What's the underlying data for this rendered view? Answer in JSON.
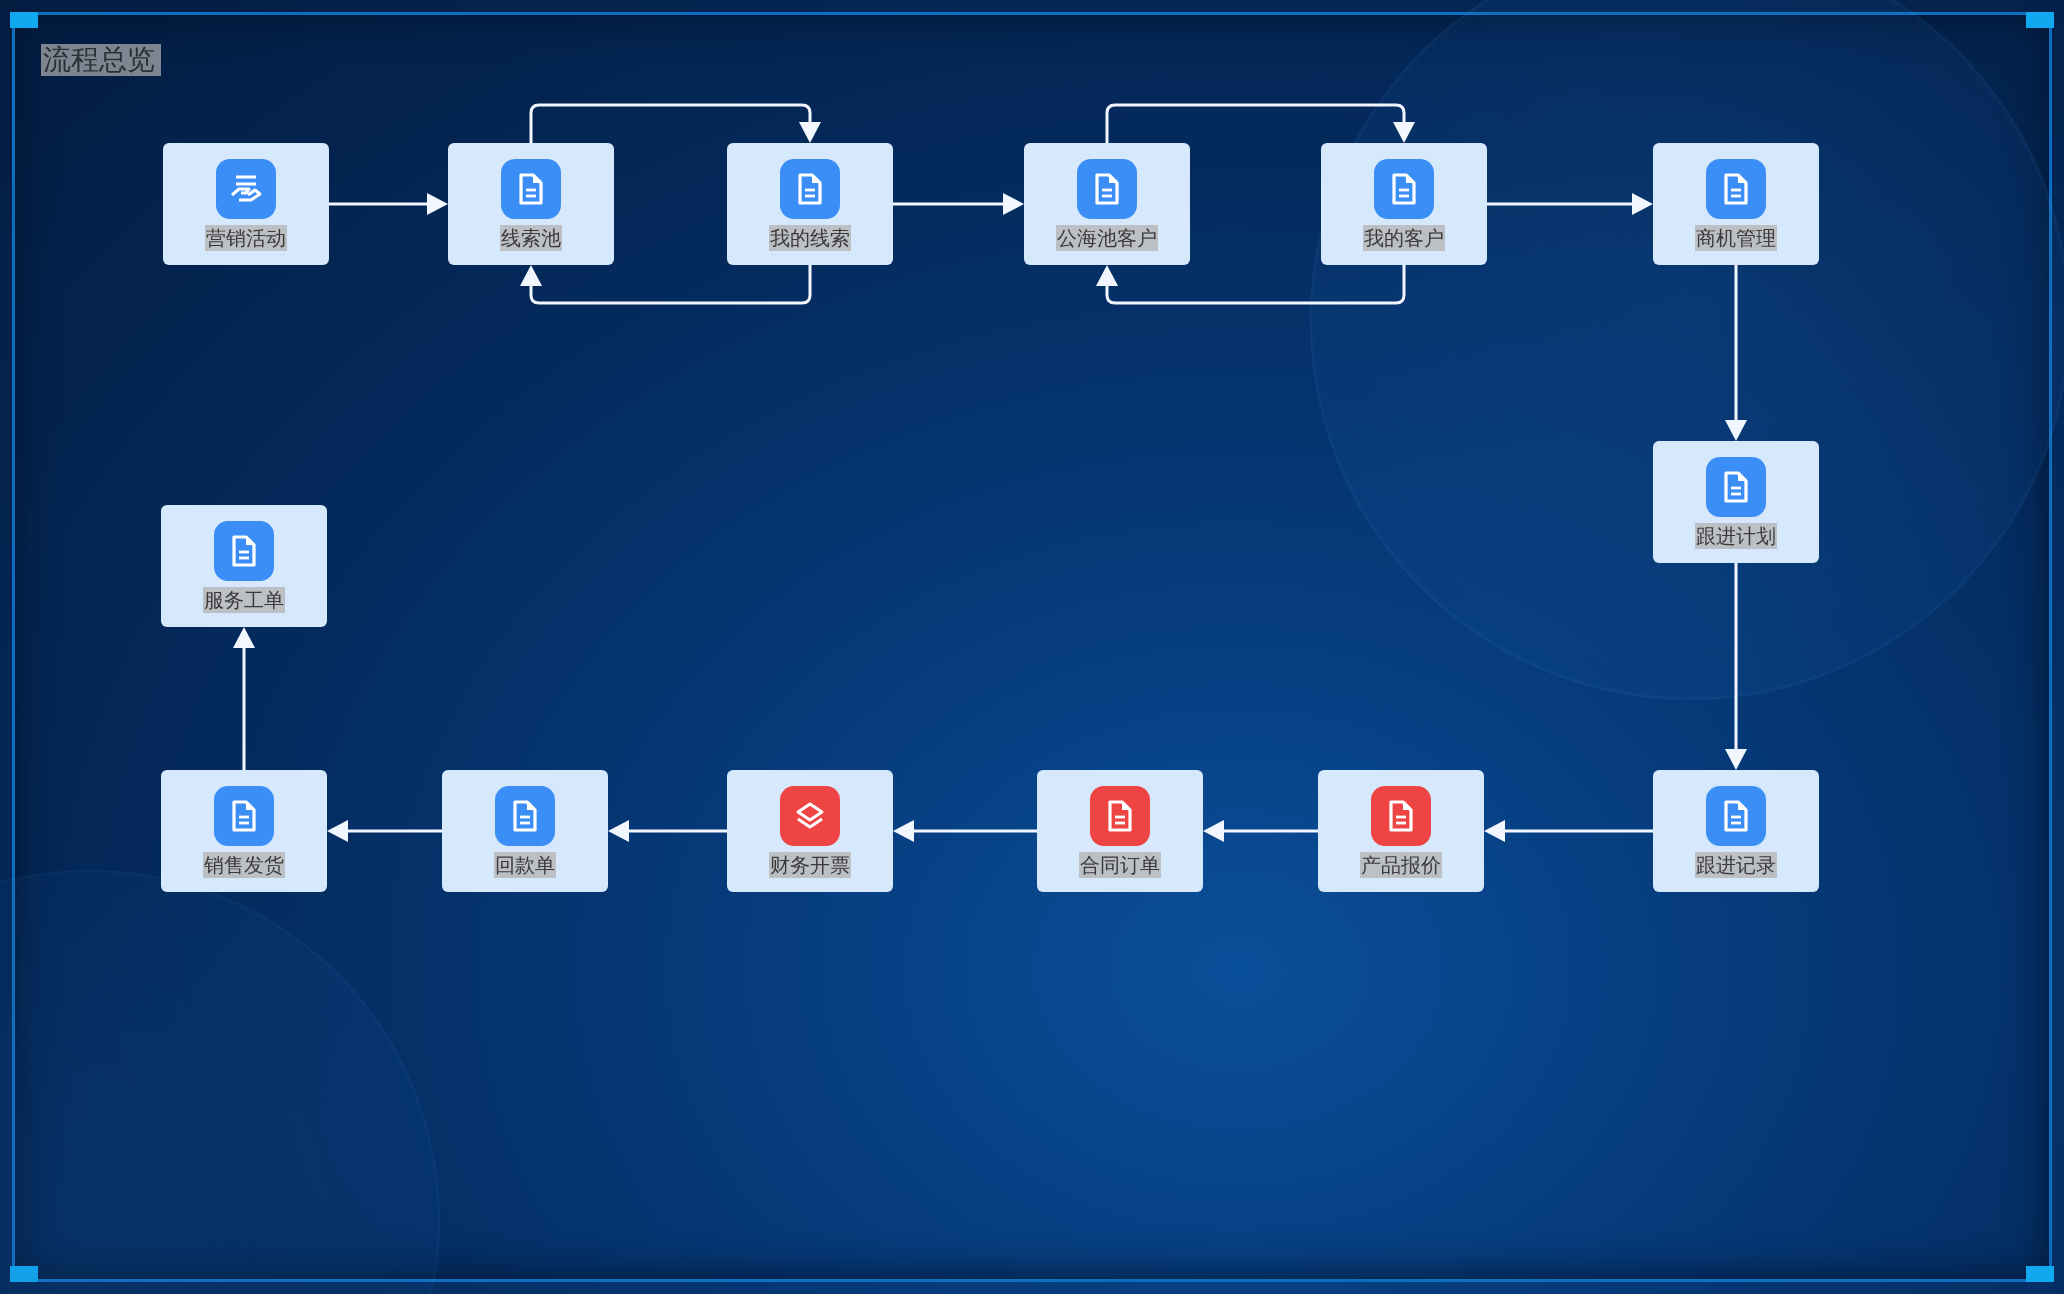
{
  "panel": {
    "title": "流程总览"
  },
  "nodes": [
    {
      "label": "营销活动",
      "kind": "handshake",
      "color": "#3a8ef6"
    },
    {
      "label": "线索池",
      "kind": "document",
      "color": "#3a8ef6"
    },
    {
      "label": "我的线索",
      "kind": "document",
      "color": "#3a8ef6"
    },
    {
      "label": "公海池客户",
      "kind": "document",
      "color": "#3a8ef6"
    },
    {
      "label": "我的客户",
      "kind": "document",
      "color": "#3a8ef6"
    },
    {
      "label": "商机管理",
      "kind": "document",
      "color": "#3a8ef6"
    },
    {
      "label": "跟进计划",
      "kind": "document",
      "color": "#3a8ef6"
    },
    {
      "label": "服务工单",
      "kind": "document",
      "color": "#3a8ef6"
    },
    {
      "label": "销售发货",
      "kind": "document",
      "color": "#3a8ef6"
    },
    {
      "label": "回款单",
      "kind": "document",
      "color": "#3a8ef6"
    },
    {
      "label": "财务开票",
      "kind": "layers",
      "color": "#ef4444"
    },
    {
      "label": "合同订单",
      "kind": "document",
      "color": "#ef4444"
    },
    {
      "label": "产品报价",
      "kind": "document",
      "color": "#ef4444"
    },
    {
      "label": "跟进记录",
      "kind": "document",
      "color": "#3a8ef6"
    }
  ]
}
